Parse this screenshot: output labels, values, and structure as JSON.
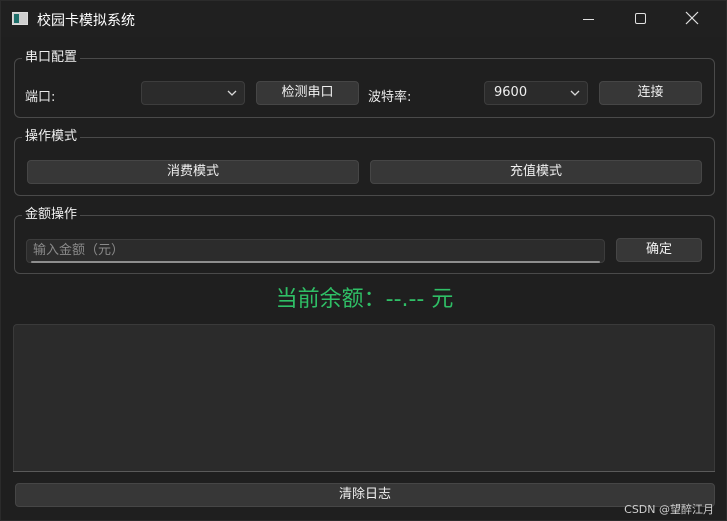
{
  "window": {
    "title": "校园卡模拟系统"
  },
  "serial": {
    "group_title": "串口配置",
    "port_label": "端口:",
    "port_value": "",
    "detect_button": "检测串口",
    "baud_label": "波特率:",
    "baud_value": "9600",
    "connect_button": "连接"
  },
  "mode": {
    "group_title": "操作模式",
    "consume_button": "消费模式",
    "recharge_button": "充值模式"
  },
  "amount": {
    "group_title": "金额操作",
    "placeholder": "输入金额（元）",
    "confirm_button": "确定"
  },
  "balance": {
    "text": "当前余额：--.-- 元",
    "color": "#2fbf66"
  },
  "log": {
    "content": "",
    "clear_button": "清除日志"
  },
  "watermark": "CSDN @望醉江月"
}
